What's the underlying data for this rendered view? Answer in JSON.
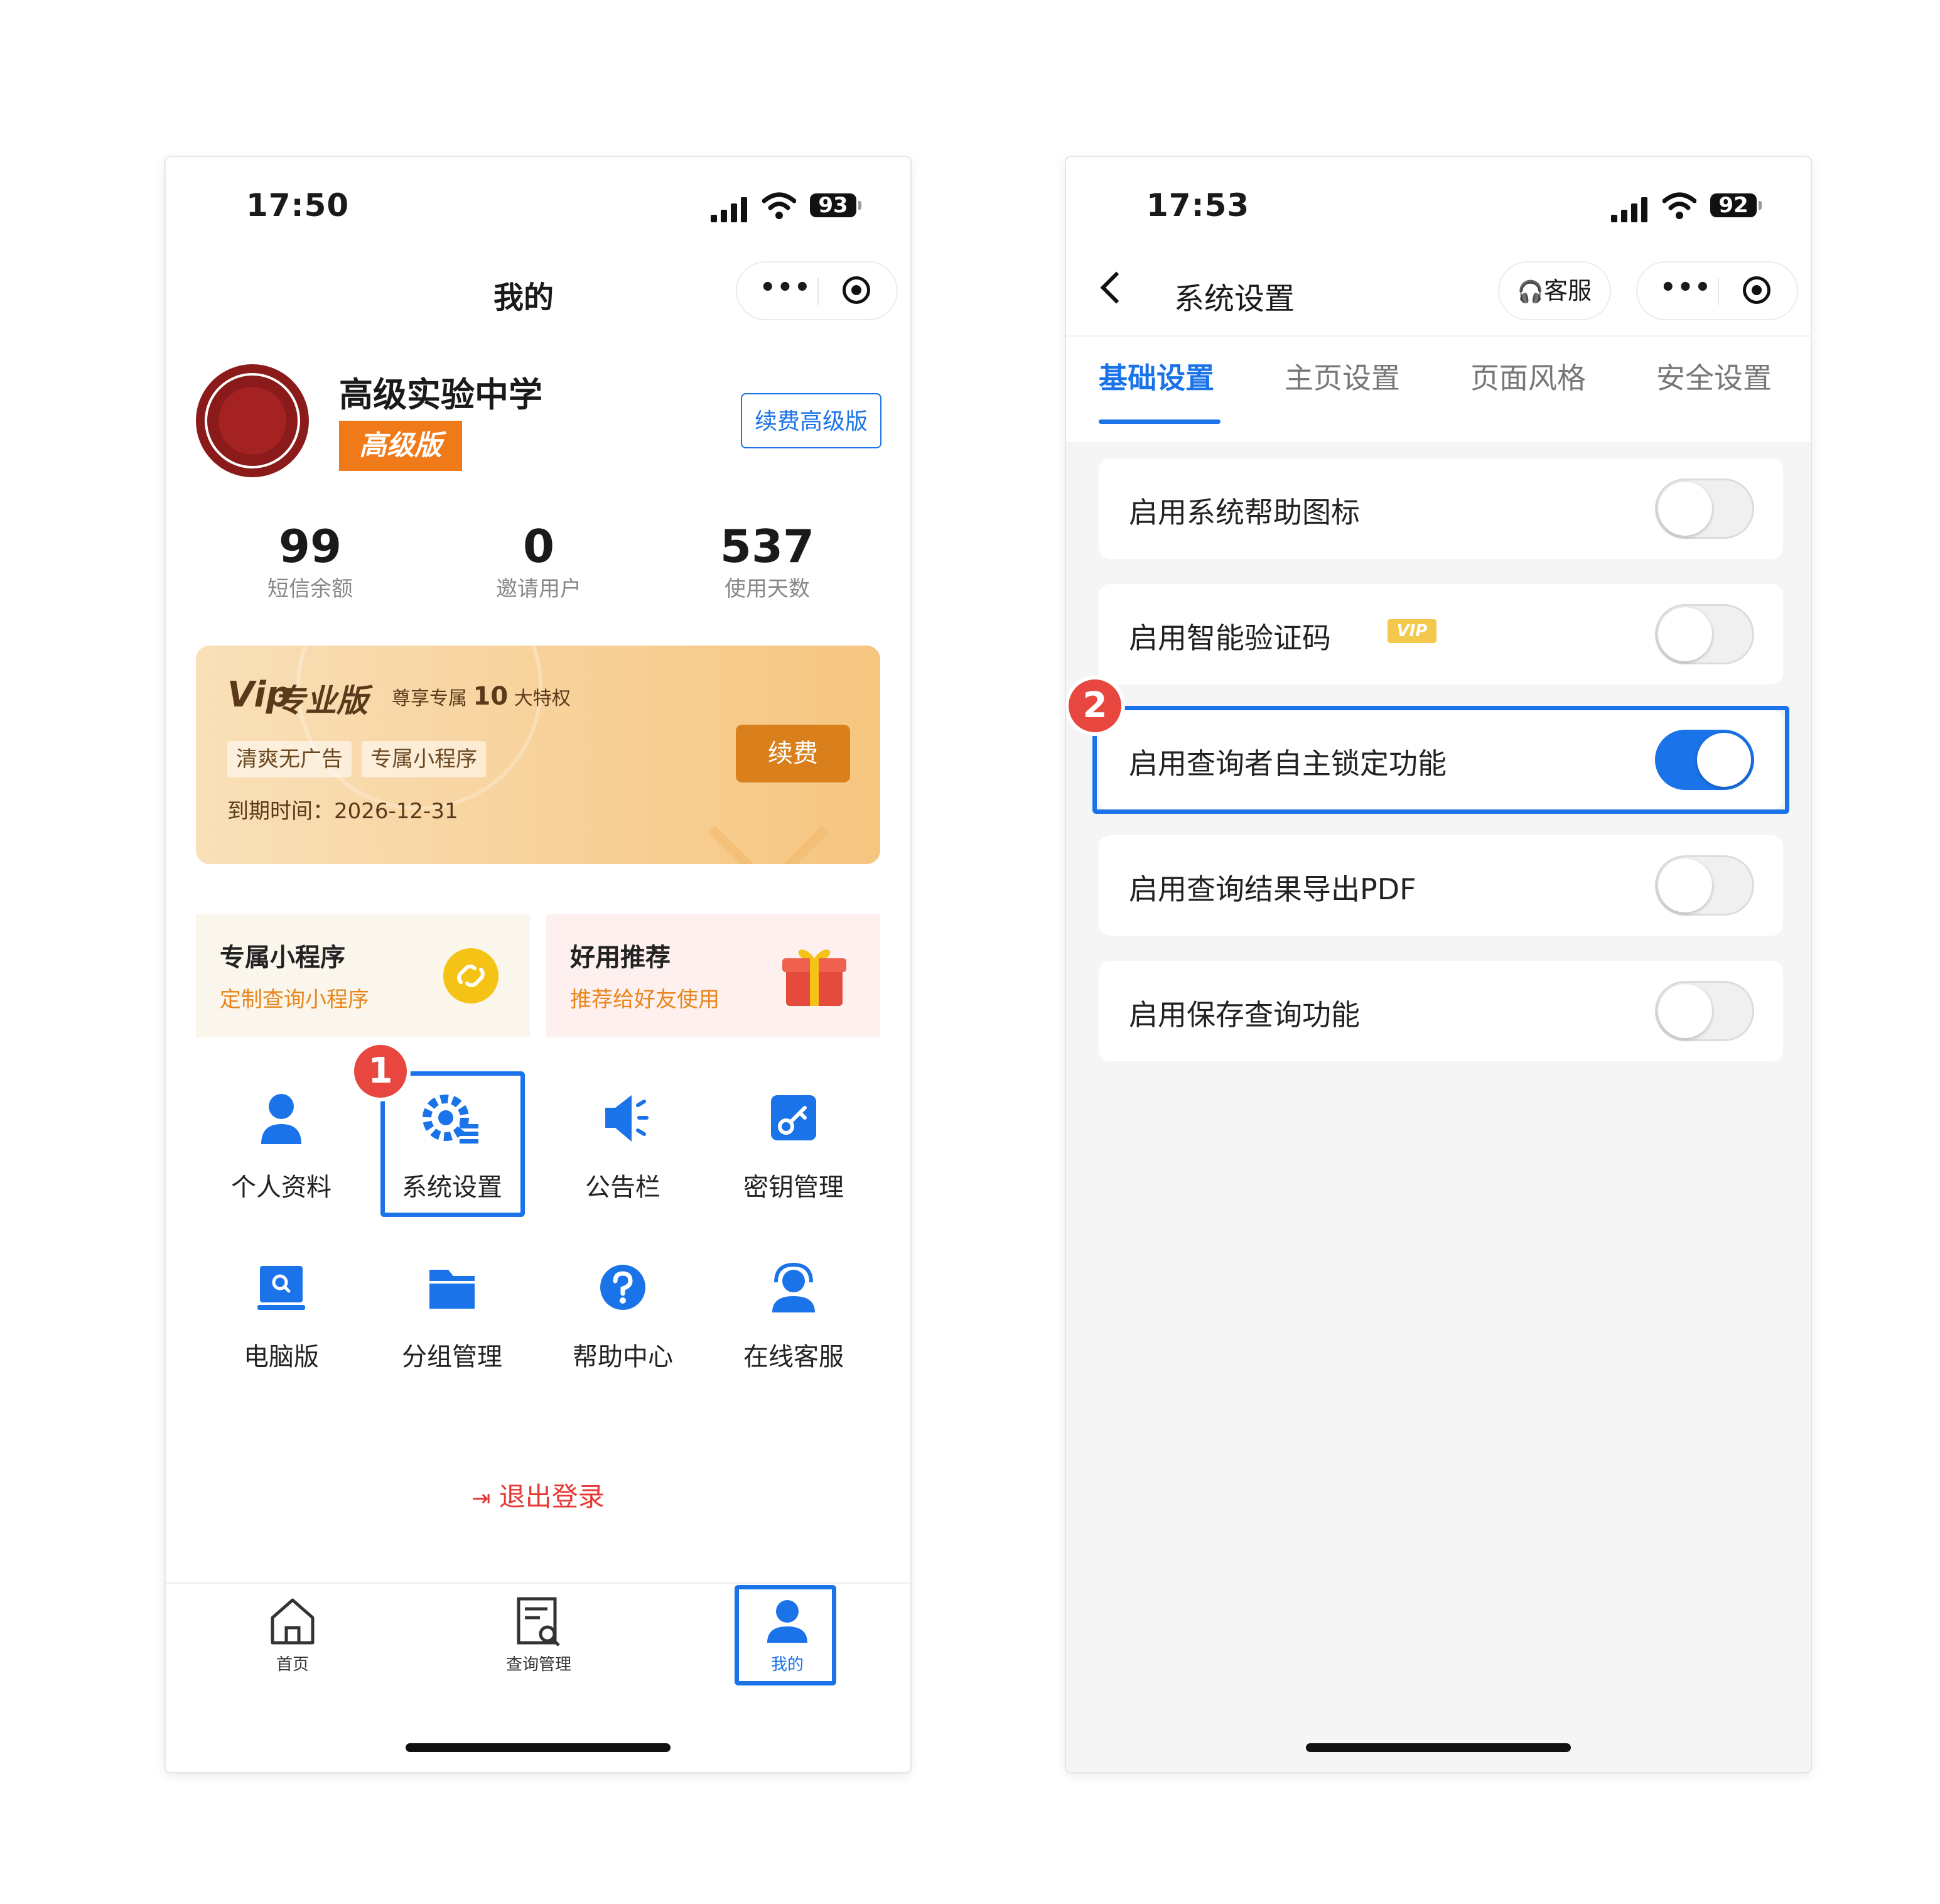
{
  "left_phone": {
    "status": {
      "time": "17:50",
      "battery": "93"
    },
    "nav_title": "我的",
    "profile": {
      "school_name": "高级实验中学",
      "tier_badge": "高级版",
      "renew_button": "续费高级版"
    },
    "stats": [
      {
        "value": "99",
        "label": "短信余额"
      },
      {
        "value": "0",
        "label": "邀请用户"
      },
      {
        "value": "537",
        "label": "使用天数"
      }
    ],
    "vip_card": {
      "mark": "Vip",
      "name": "专业版",
      "desc_prefix": "尊享专属",
      "desc_count": "10",
      "desc_suffix": "大特权",
      "tags": [
        "清爽无广告",
        "专属小程序"
      ],
      "expiry_label": "到期时间：",
      "expiry_date": "2026-12-31",
      "renew_button": "续费"
    },
    "promo_cards": [
      {
        "title": "专属小程序",
        "subtitle": "定制查询小程序",
        "icon": "link-icon"
      },
      {
        "title": "好用推荐",
        "subtitle": "推荐给好友使用",
        "icon": "gift-icon"
      }
    ],
    "menu": [
      {
        "label": "个人资料",
        "icon": "person-icon"
      },
      {
        "label": "系统设置",
        "icon": "settings-gear-icon"
      },
      {
        "label": "公告栏",
        "icon": "megaphone-icon"
      },
      {
        "label": "密钥管理",
        "icon": "key-icon"
      },
      {
        "label": "电脑版",
        "icon": "monitor-icon"
      },
      {
        "label": "分组管理",
        "icon": "folder-icon"
      },
      {
        "label": "帮助中心",
        "icon": "question-icon"
      },
      {
        "label": "在线客服",
        "icon": "headset-icon"
      }
    ],
    "step_badge": "1",
    "logout": "退出登录",
    "tabbar": [
      {
        "label": "首页",
        "icon": "home-icon"
      },
      {
        "label": "查询管理",
        "icon": "query-doc-icon"
      },
      {
        "label": "我的",
        "icon": "user-icon"
      }
    ]
  },
  "right_phone": {
    "status": {
      "time": "17:53",
      "battery": "92"
    },
    "nav_title": "系统设置",
    "service_button": "客服",
    "tabs": [
      "基础设置",
      "主页设置",
      "页面风格",
      "安全设置"
    ],
    "active_tab": "基础设置",
    "step_badge": "2",
    "settings": [
      {
        "label": "启用系统帮助图标",
        "enabled": false
      },
      {
        "label": "启用智能验证码",
        "enabled": false,
        "tag": "VIP"
      },
      {
        "label": "启用查询者自主锁定功能",
        "enabled": true
      },
      {
        "label": "启用查询结果导出PDF",
        "enabled": false
      },
      {
        "label": "启用保存查询功能",
        "enabled": false
      }
    ]
  },
  "colors": {
    "accent": "#1a73e8",
    "badge": "#e8473f",
    "orange": "#f07a1a",
    "logout": "#e53935"
  }
}
